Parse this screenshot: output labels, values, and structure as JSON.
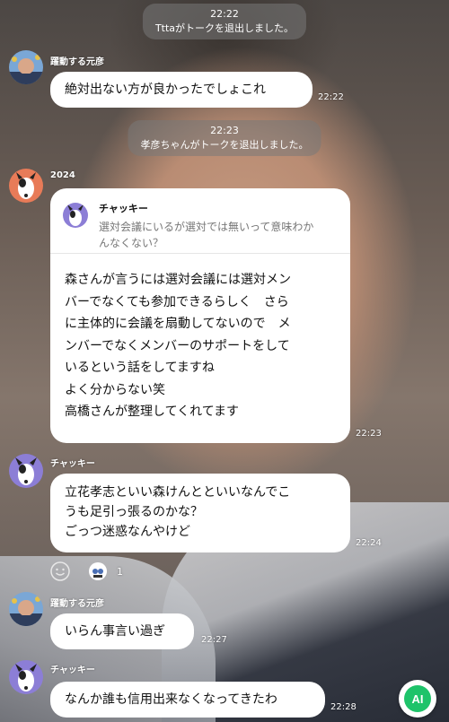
{
  "system_messages": [
    {
      "time": "22:22",
      "text": "Tttaがトークを退出しました。"
    },
    {
      "time": "22:23",
      "text": "孝彦ちゃんがトークを退出しました。"
    }
  ],
  "messages": [
    {
      "sender": "躍動する元彦",
      "text": "絶対出ない方が良かったでしょこれ",
      "time": "22:22"
    },
    {
      "sender": "2024",
      "quote": {
        "name": "チャッキー",
        "text": "選対会議にいるが選対では無いって意味わかんなくない？"
      },
      "lines": [
        "森さんが言うには選対会議には選対メン",
        "バーでなくても参加できるらしく　さら",
        "に主体的に会議を扇動してないので　メ",
        "ンバーでなくメンバーのサポートをして",
        "いるという話をしてますね",
        "よく分からない笑",
        "高橋さんが整理してくれてます"
      ],
      "time": "22:23"
    },
    {
      "sender": "チャッキー",
      "lines": [
        "立花孝志といい森けんとといいなんでこ",
        "うも足引っ張るのかな？",
        "ごっつ迷惑なんやけど"
      ],
      "time": "22:24",
      "reaction_count": "1"
    },
    {
      "sender": "躍動する元彦",
      "text": "いらん事言い過ぎ",
      "time": "22:27"
    },
    {
      "sender": "チャッキー",
      "text": "なんか誰も信用出来なくなってきたわ",
      "time": "22:28"
    }
  ],
  "ai_button_label": "AI",
  "colors": {
    "ai_green": "#1ec36a",
    "bubble": "#ffffff",
    "system_bg": "#787878"
  }
}
